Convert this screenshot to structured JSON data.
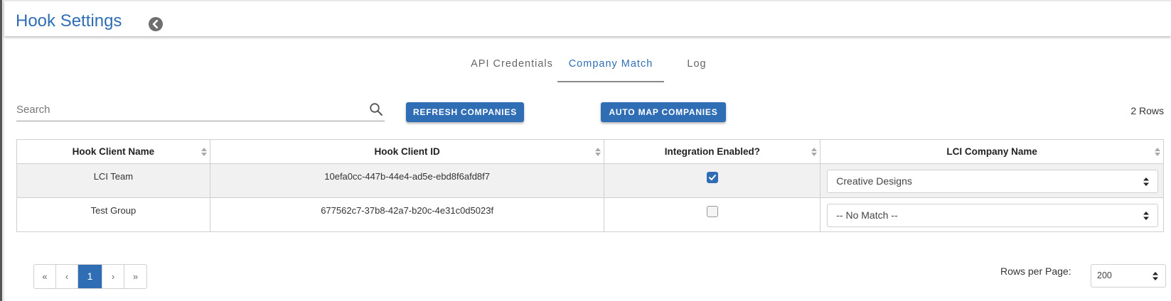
{
  "header": {
    "title": "Hook Settings",
    "back_icon": "chevron-left-circle-icon"
  },
  "tabs": [
    {
      "label": "API Credentials",
      "active": false
    },
    {
      "label": "Company Match",
      "active": true
    },
    {
      "label": "Log",
      "active": false
    }
  ],
  "toolbar": {
    "search_placeholder": "Search",
    "search_value": "",
    "refresh_label": "REFRESH COMPANIES",
    "automap_label": "AUTO MAP COMPANIES",
    "rows_count": "2 Rows"
  },
  "table": {
    "columns": [
      "Hook Client Name",
      "Hook Client ID",
      "Integration Enabled?",
      "LCI Company Name"
    ],
    "rows": [
      {
        "client_name": "LCI Team",
        "client_id": "10efa0cc-447b-44e4-ad5e-ebd8f6afd8f7",
        "enabled": true,
        "company": "Creative Designs"
      },
      {
        "client_name": "Test Group",
        "client_id": "677562c7-37b8-42a7-b20c-4e31c0d5023f",
        "enabled": false,
        "company": "-- No Match --"
      }
    ]
  },
  "pagination": {
    "first": "«",
    "prev": "‹",
    "current": "1",
    "next": "›",
    "last": "»",
    "rows_per_page_label": "Rows per Page:",
    "rows_per_page_value": "200"
  },
  "colors": {
    "accent": "#2f6eb5",
    "stripe": "#f1f1f1",
    "border": "#cfcfcf"
  }
}
